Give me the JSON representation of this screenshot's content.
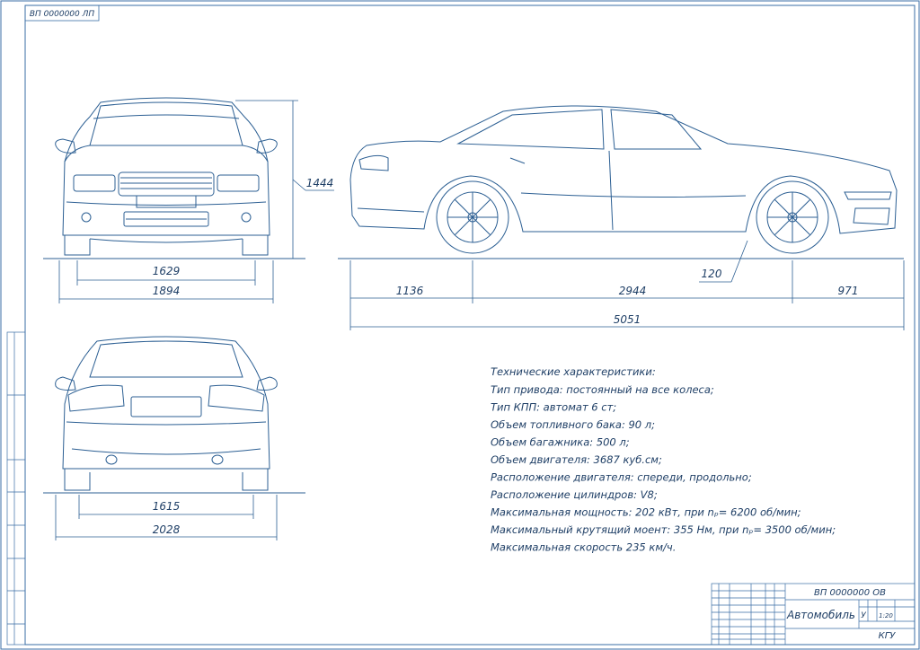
{
  "drawing": {
    "code_stamp": "ВП 0000000 ЛП",
    "title_code": "ВП 0000000 ОВ",
    "title_name": "Автомобиль",
    "org": "КГУ",
    "scale": "1:20",
    "letter": "У"
  },
  "dimensions": {
    "front_height": "1444",
    "front_track": "1629",
    "front_width": "1894",
    "rear_track": "1615",
    "rear_width": "2028",
    "front_overhang": "1136",
    "wheelbase": "2944",
    "rear_overhang": "971",
    "overall_length": "5051",
    "ground_clearance": "120"
  },
  "specs": {
    "heading": "Технические характеристики:",
    "lines": [
      "Тип привода: постоянный на все колеса;",
      "Тип КПП: автомат 6 ст;",
      "Объем топливного бака: 90 л;",
      "Объем багажника: 500 л;",
      "Объем двигателя: 3687 куб.см;",
      "Расположение двигателя: спереди, продольно;",
      "Расположение цилиндров: V8;",
      "Максимальная мощность: 202 кВт, при nₚ= 6200 об/мин;",
      "Максимальный крутящий моент: 355 Нм, при nₚ= 3500 об/мин;",
      "Максимальная скорость 235 км/ч."
    ]
  },
  "colors": {
    "line": "#2c5f93",
    "text": "#1f3f66",
    "frame": "#3a6ea5"
  }
}
